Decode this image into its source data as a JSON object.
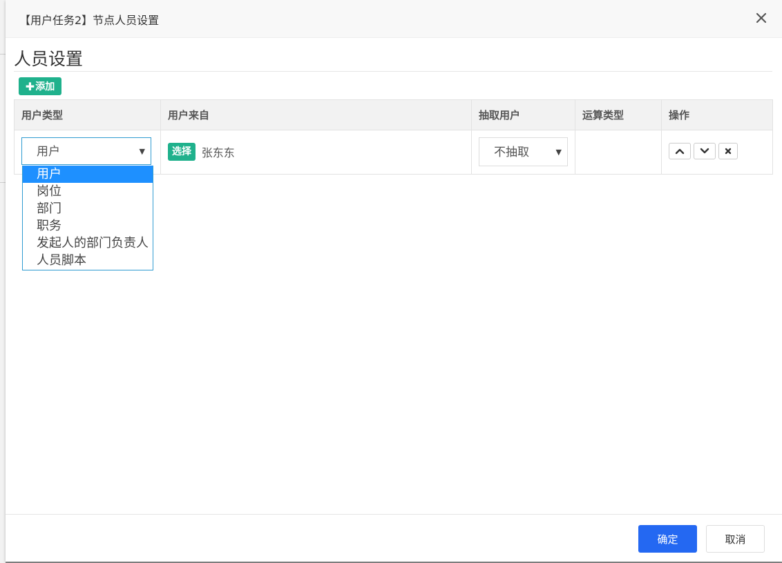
{
  "dialog": {
    "title": "【用户任务2】节点人员设置"
  },
  "section": {
    "title": "人员设置"
  },
  "toolbar": {
    "add_label": "添加",
    "add_icon": "plus-icon"
  },
  "table": {
    "headers": [
      "用户类型",
      "用户来自",
      "抽取用户",
      "运算类型",
      "操作"
    ],
    "rows": [
      {
        "user_type": "用户",
        "choose_label": "选择",
        "source": "张东东",
        "extract": "不抽取",
        "operation": ""
      }
    ]
  },
  "dropdown": {
    "options": [
      "用户",
      "岗位",
      "部门",
      "职务",
      "发起人的部门负责人",
      "人员脚本"
    ],
    "selected_index": 0
  },
  "footer": {
    "ok_label": "确定",
    "cancel_label": "取消"
  },
  "colors": {
    "accent_green": "#1fb18c",
    "primary_blue": "#2468f2",
    "selection_blue": "#1e90ff"
  }
}
